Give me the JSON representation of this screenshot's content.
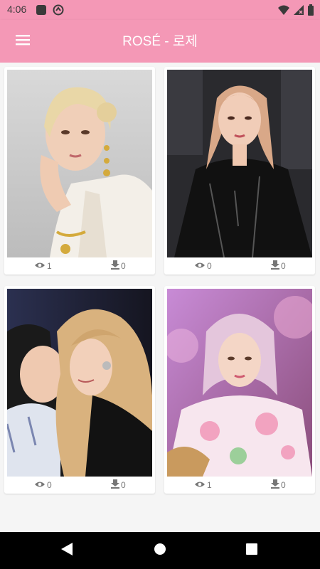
{
  "status_bar": {
    "time": "4:06"
  },
  "app_bar": {
    "title": "ROSÉ - 로제"
  },
  "cards": [
    {
      "views": "1",
      "downloads": "0"
    },
    {
      "views": "0",
      "downloads": "0"
    },
    {
      "views": "0",
      "downloads": "0"
    },
    {
      "views": "1",
      "downloads": "0"
    }
  ],
  "icons": {
    "menu": "hamburger-icon",
    "views": "eye-icon",
    "downloads": "download-icon",
    "back": "back-triangle-icon",
    "home": "home-circle-icon",
    "recents": "recents-square-icon"
  },
  "colors": {
    "app_bar": "#f498b6",
    "background": "#f5f5f5",
    "nav_bar": "#000000"
  }
}
